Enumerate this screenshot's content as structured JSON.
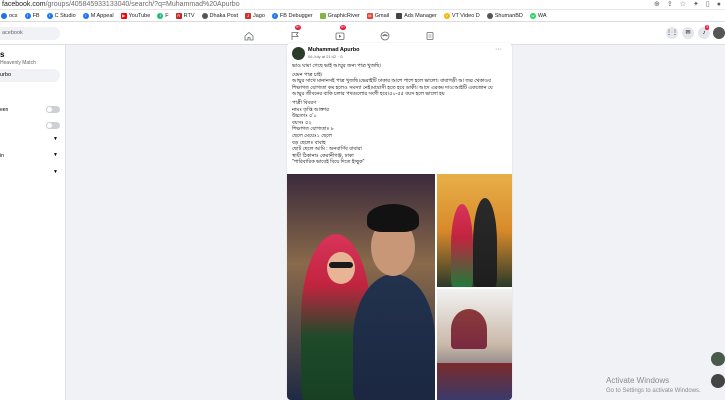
{
  "browser": {
    "url_host": "facebook.com",
    "url_path": "/groups/405845933133040/search/?q=Muhammad%20Apurbo"
  },
  "bookmarks": [
    {
      "label": "ocs",
      "icon": "doc-icon",
      "color": "#1a73e8"
    },
    {
      "label": "FB",
      "icon": "facebook-icon",
      "color": "#1877f2"
    },
    {
      "label": "C Studio",
      "icon": "facebook-icon",
      "color": "#1877f2"
    },
    {
      "label": "M Appeal",
      "icon": "facebook-icon",
      "color": "#1877f2"
    },
    {
      "label": "YouTube",
      "icon": "youtube-icon",
      "color": "#ff0000"
    },
    {
      "label": "F",
      "icon": "fiverr-icon",
      "color": "#1dbf73"
    },
    {
      "label": "RTV",
      "icon": "rtv-icon",
      "color": "#c62828"
    },
    {
      "label": "Dhaka Post",
      "icon": "globe-icon",
      "color": "#555555"
    },
    {
      "label": "Jago",
      "icon": "jago-icon",
      "color": "#d32f2f"
    },
    {
      "label": "FB Debugger",
      "icon": "facebook-icon",
      "color": "#1877f2"
    },
    {
      "label": "GraphicRiver",
      "icon": "graphicriver-icon",
      "color": "#82b541"
    },
    {
      "label": "Gmail",
      "icon": "gmail-icon",
      "color": "#ea4335"
    },
    {
      "label": "Ads Manager",
      "icon": "ads-icon",
      "color": "#444444"
    },
    {
      "label": "VT Video D",
      "icon": "vt-icon",
      "color": "#f4b400"
    },
    {
      "label": "ShumanBD",
      "icon": "globe-icon",
      "color": "#555555"
    },
    {
      "label": "WA",
      "icon": "whatsapp-icon",
      "color": "#25d366"
    }
  ],
  "fbnav": {
    "search_placeholder": "acebook",
    "badge_groups": "9+",
    "badge_watch": "9+",
    "badge_notifications": "3"
  },
  "sidebar": {
    "title": "s",
    "subtitle": "Heavenly Match",
    "search_value": "urbo",
    "rows": [
      "een",
      "",
      "in",
      ""
    ]
  },
  "post": {
    "author": "Muhammad Apurbo",
    "time": "06 July at 21:42 · ⊙",
    "more": "···",
    "lines": [
      "ভাও ঘামা গেছে ভাই আম্মুর জন্য পাত্র খুজছি।",
      "",
      "যেমন পাত্র চাই।",
      "আম্মুর সাথে মানানসই পাত্র খুজছি।ভেরাইটি ঢাকার আশে পাশে হলে ভালো। বাবাগড়ী আ জৱ থেকাওব",
      "শিক্ষাগত যোগ্যতা কম হলেও সমস্যা নেই।মাদ্রাসী হতে হবে ডাকী। আদে এরকম দাও:আইটি একজোন যে",
      "আম্মুর জীবনের বাকি চলার পথগুলোর সংগী হবে।৫০-৫৫ বয়স হলে ভালো হয়",
      "",
      "পাত্রী বিবরণ",
      "নামঃ তৃপ্তি আক্তার",
      "উচ্চতাঃ ৫'০",
      "বয়সঃ ৫২",
      "শিক্ষাগত যোগ্যতাঃ ৮",
      "ছেলে মেয়েঃ১ ছেলে",
      "বড় ছেলেঃ বাবাহ",
      "ছোট ছেলে আমি : অনবার্ণিব বাবারা",
      "স্থায়ী ঠিকানাঃ কেরানীগঞ্জ, ঢাকা",
      "\"পারিবারিক ভাবেই বিয়ে দিতে ইচ্ছুক\""
    ]
  },
  "watermark": {
    "title": "Activate Windows",
    "subtitle": "Go to Settings to activate Windows."
  }
}
